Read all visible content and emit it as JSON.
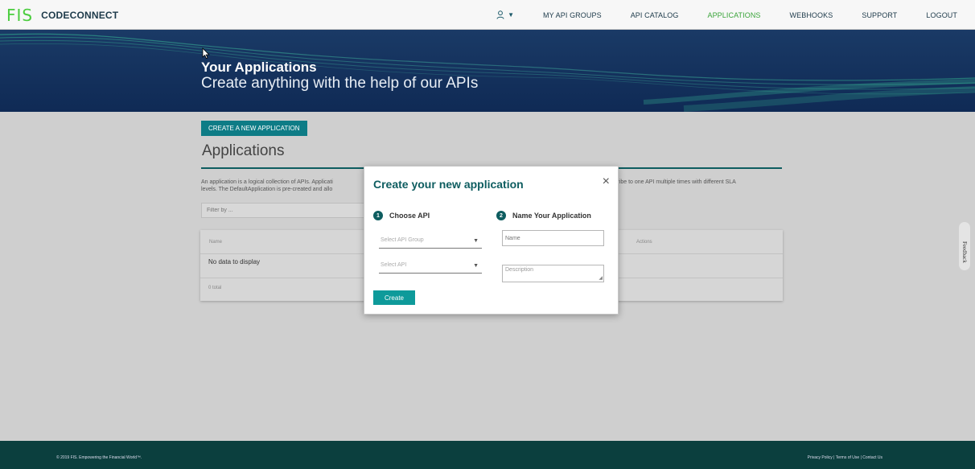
{
  "nav": {
    "logo_fis": "FIS",
    "logo_product": "CODECONNECT",
    "items": [
      {
        "label": "MY API GROUPS",
        "active": false
      },
      {
        "label": "API CATALOG",
        "active": false
      },
      {
        "label": "APPLICATIONS",
        "active": true
      },
      {
        "label": "WEBHOOKS",
        "active": false
      },
      {
        "label": "SUPPORT",
        "active": false
      },
      {
        "label": "LOGOUT",
        "active": false
      }
    ]
  },
  "hero": {
    "title": "Your Applications",
    "subtitle": "Create anything with the help of our APIs"
  },
  "content": {
    "new_app_button": "CREATE A NEW APPLICATION",
    "heading": "Applications",
    "description_left": "An application is a logical collection of APIs. Applicati",
    "description_left_2": "levels. The DefaultApplication is pre-created and allo",
    "description_right": "cribe to one API multiple times with different SLA",
    "filter_placeholder": "Filter by ...",
    "table": {
      "col_name": "Name",
      "col_actions": "Actions",
      "empty_message": "No data to display",
      "total": "0 total"
    }
  },
  "modal": {
    "title": "Create your new application",
    "close_label": "×",
    "step1_num": "1",
    "step1_label": "Choose API",
    "step2_num": "2",
    "step2_label": "Name Your Application",
    "select_group_placeholder": "Select API Group",
    "select_api_placeholder": "Select API",
    "name_placeholder": "Name",
    "description_placeholder": "Description",
    "create_button": "Create"
  },
  "feedback_label": "Feedback",
  "footer": {
    "copyright": "© 2019 FIS. Empowering the Financial World™.",
    "links": "Privacy Policy | Terms of Use | Contact Us"
  },
  "colors": {
    "accent": "#0e5d60",
    "nav_active": "#3aa43a",
    "hero_bg": "#0f2a55",
    "footer_bg": "#0b3f3e"
  }
}
